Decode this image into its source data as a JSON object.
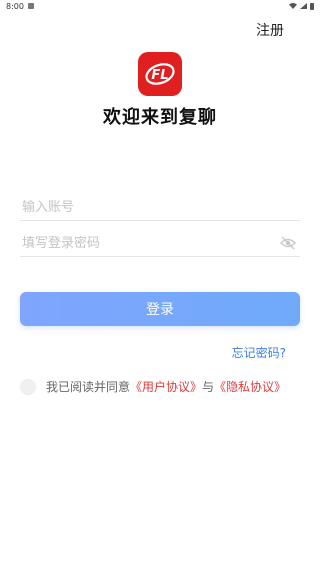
{
  "status_bar": {
    "time": "8:00"
  },
  "header": {
    "register_label": "注册"
  },
  "title": "欢迎来到复聊",
  "form": {
    "account_placeholder": "输入账号",
    "password_placeholder": "填写登录密码",
    "login_label": "登录",
    "forgot_label": "忘记密码?"
  },
  "agreement": {
    "prefix": "我已阅读并同意",
    "user_link": "《用户协议》",
    "conjunction": "与",
    "privacy_link": "《隐私协议》"
  },
  "colors": {
    "accent": "#6faaf8",
    "brand_red": "#e02020",
    "link_blue": "#3b7de8",
    "link_red": "#e03b3b"
  }
}
